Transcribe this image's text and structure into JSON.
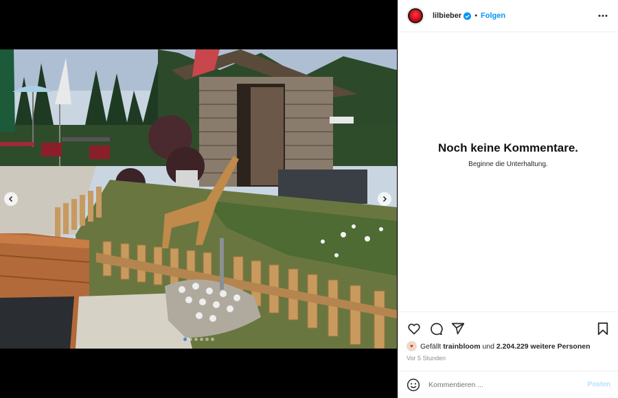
{
  "header": {
    "username": "lilbieber",
    "separator": "•",
    "follow_label": "Folgen"
  },
  "comments": {
    "empty_title": "Noch keine Kommentare.",
    "empty_subtitle": "Beginne die Unterhaltung."
  },
  "likes": {
    "prefix": "Gefällt",
    "first_user": "trainbloom",
    "connector": "und",
    "others": "2.204.229 weitere Personen"
  },
  "timestamp": "Vor 5 Stunden",
  "comment_bar": {
    "placeholder": "Kommentieren ...",
    "post_label": "Posten"
  },
  "carousel": {
    "slide_count": 6,
    "active_index": 0
  },
  "icons": [
    "heart-icon",
    "comment-icon",
    "share-icon",
    "bookmark-icon",
    "emoji-icon",
    "more-icon",
    "verified-icon",
    "chevron-left-icon",
    "chevron-right-icon"
  ],
  "colors": {
    "link": "#0095f6",
    "post_disabled": "#b2dffc",
    "verified": "#0095f6"
  }
}
